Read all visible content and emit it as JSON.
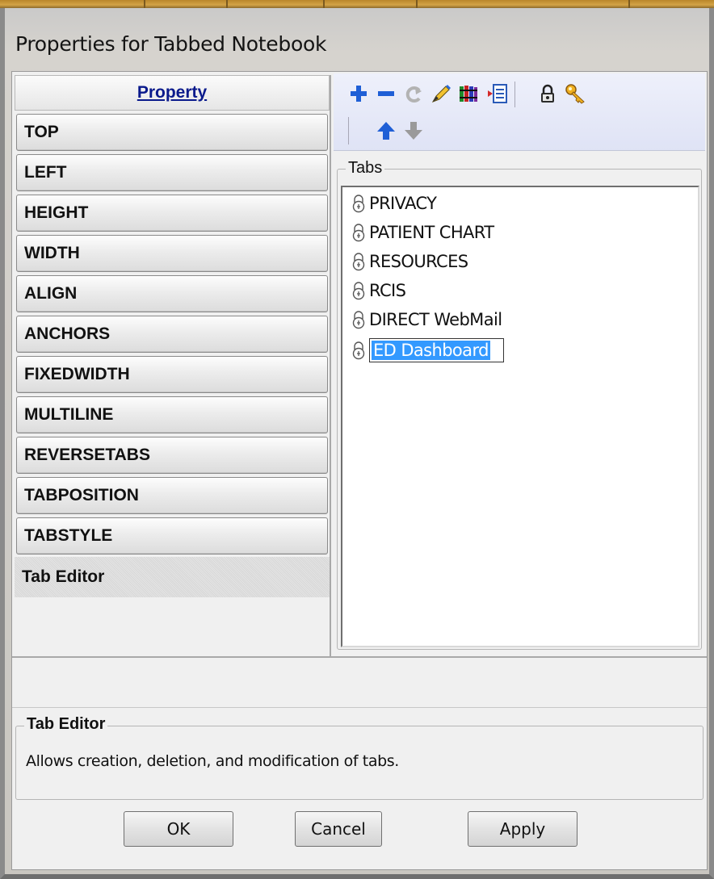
{
  "window": {
    "title": "Properties for Tabbed Notebook"
  },
  "property_list": {
    "header": "Property",
    "items": [
      {
        "label": "TOP"
      },
      {
        "label": "LEFT"
      },
      {
        "label": "HEIGHT"
      },
      {
        "label": "WIDTH"
      },
      {
        "label": "ALIGN"
      },
      {
        "label": "ANCHORS"
      },
      {
        "label": "FIXEDWIDTH"
      },
      {
        "label": "MULTILINE"
      },
      {
        "label": "REVERSETABS"
      },
      {
        "label": "TABPOSITION"
      },
      {
        "label": "TABSTYLE"
      },
      {
        "label": "Tab Editor",
        "selected": true
      }
    ]
  },
  "toolbar": {
    "icons": [
      "add-icon",
      "remove-icon",
      "undo-icon",
      "edit-pencil-icon",
      "books-icon",
      "insert-list-icon",
      "lock-icon",
      "key-icon",
      "move-up-icon",
      "move-down-icon"
    ]
  },
  "tabs_editor": {
    "group_label": "Tabs",
    "items": [
      {
        "label": "PRIVACY"
      },
      {
        "label": "PATIENT CHART"
      },
      {
        "label": "RESOURCES"
      },
      {
        "label": "RCIS"
      },
      {
        "label": "DIRECT WebMail"
      },
      {
        "label": "ED Dashboard",
        "editing": true
      }
    ]
  },
  "description": {
    "title": "Tab Editor",
    "text": "Allows creation, deletion, and modification of tabs."
  },
  "buttons": {
    "ok": "OK",
    "cancel": "Cancel",
    "apply": "Apply"
  },
  "colors": {
    "header_link": "#0a1a8c",
    "selection": "#3399ff",
    "toolbar_blue": "#1f5fd6"
  }
}
